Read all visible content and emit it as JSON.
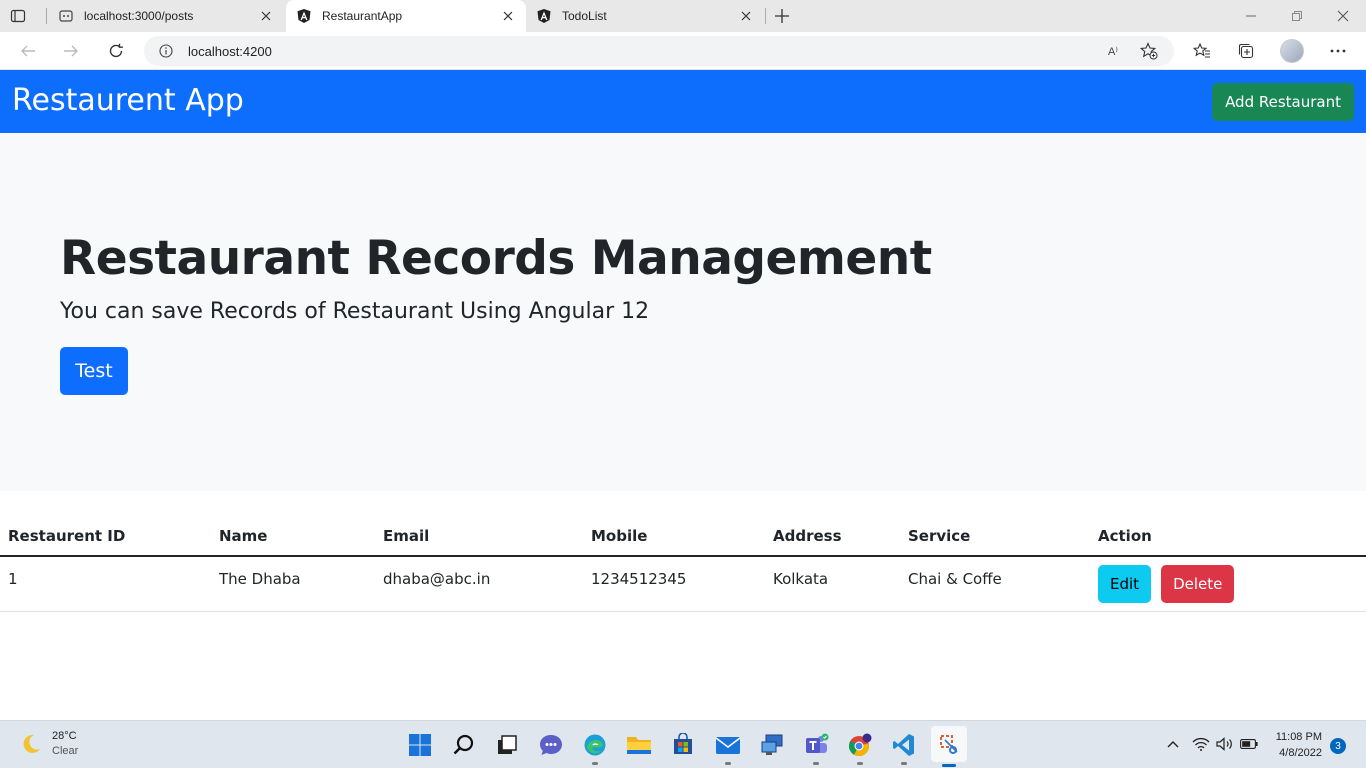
{
  "browser": {
    "tabs": [
      {
        "title": "localhost:3000/posts",
        "icon": "globe-icon"
      },
      {
        "title": "RestaurantApp",
        "icon": "angular-icon",
        "active": true
      },
      {
        "title": "TodoList",
        "icon": "angular-icon"
      }
    ],
    "address": "localhost:4200",
    "read_aloud_label": "A⁾"
  },
  "app": {
    "brand": "Restaurent App",
    "add_button": "Add Restaurant",
    "hero": {
      "title": "Restaurant Records Management",
      "subtitle": "You can save Records of Restaurant Using Angular 12",
      "button": "Test"
    },
    "table": {
      "headers": [
        "Restaurent ID",
        "Name",
        "Email",
        "Mobile",
        "Address",
        "Service",
        "Action"
      ],
      "rows": [
        {
          "id": "1",
          "name": "The Dhaba",
          "email": "dhaba@abc.in",
          "mobile": "1234512345",
          "address": "Kolkata",
          "service": "Chai & Coffe"
        }
      ],
      "edit_label": "Edit",
      "delete_label": "Delete"
    },
    "colors": {
      "primary": "#0d6efd",
      "success": "#198754",
      "info": "#0dcaf0",
      "danger": "#dc3545"
    }
  },
  "taskbar": {
    "weather_temp": "28°C",
    "weather_cond": "Clear",
    "time": "11:08 PM",
    "date": "4/8/2022",
    "notifications": "3"
  }
}
